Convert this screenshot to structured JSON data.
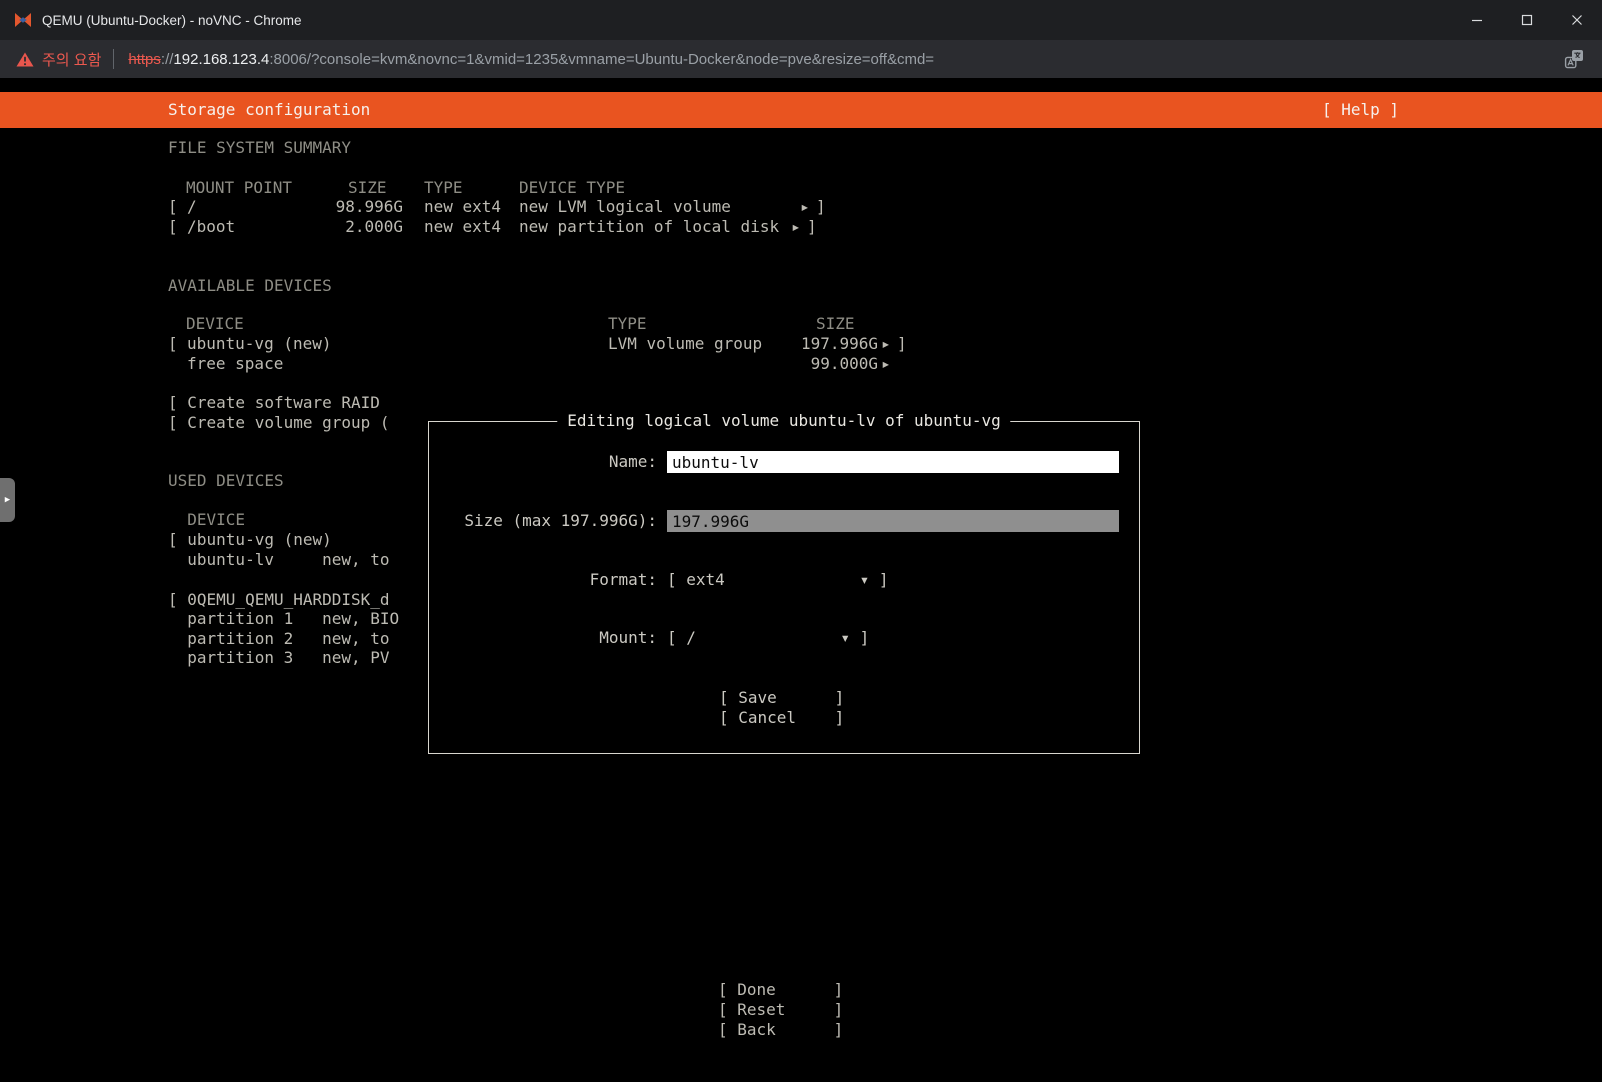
{
  "window": {
    "title": "QEMU (Ubuntu-Docker) - noVNC - Chrome"
  },
  "omnibox": {
    "warning": "주의 요함",
    "scheme": "https",
    "separator": "://",
    "host": "192.168.123.4",
    "path": ":8006/?console=kvm&novnc=1&vmid=1235&vmname=Ubuntu-Docker&node=pve&resize=off&cmd="
  },
  "header": {
    "title": "Storage configuration",
    "help": "[ Help ]"
  },
  "fs": {
    "heading": "FILE SYSTEM SUMMARY",
    "columns": {
      "mount": "MOUNT POINT",
      "size": "SIZE",
      "type": "TYPE",
      "device": "DEVICE TYPE"
    },
    "rows": [
      {
        "open": "[",
        "mount": "/",
        "size": "98.996G",
        "type": "new ext4",
        "device": "new LVM logical volume",
        "arrow": "▸",
        "close": "]"
      },
      {
        "open": "[",
        "mount": "/boot",
        "size": "2.000G",
        "type": "new ext4",
        "device": "new partition of local disk",
        "arrow": "▸",
        "close": "]"
      }
    ]
  },
  "available": {
    "heading": "AVAILABLE DEVICES",
    "columns": {
      "device": "DEVICE",
      "type": "TYPE",
      "size": "SIZE"
    },
    "vg_row": {
      "open": "[",
      "device": "ubuntu-vg (new)",
      "type": "LVM volume group",
      "size": "197.996G",
      "arrow": "▸",
      "close": "]"
    },
    "free_row": {
      "device": "free space",
      "size": "99.000G",
      "arrow": "▸"
    },
    "create_raid": "[ Create software RAID",
    "create_vg": "[ Create volume group ("
  },
  "used": {
    "heading": "USED DEVICES",
    "columns": "  DEVICE",
    "vg": "[ ubuntu-vg (new)",
    "lv": "  ubuntu-lv     new, to",
    "disk": "[ 0QEMU_QEMU_HARDDISK_d",
    "p1": "  partition 1   new, BIO",
    "p2": "  partition 2   new, to",
    "p3": "  partition 3   new, PV"
  },
  "dialog": {
    "title": "Editing logical volume ubuntu-lv of ubuntu-vg",
    "name_label": "Name:",
    "name_value": "ubuntu-lv",
    "size_label": "Size (max 197.996G):",
    "size_value": "197.996G",
    "format_label": "Format:",
    "format_value": "[ ext4              ▾ ]",
    "mount_label": "Mount:",
    "mount_value": "[ /               ▾ ]",
    "save": "[ Save      ]",
    "cancel": "[ Cancel    ]"
  },
  "footer": {
    "done": "[ Done      ]",
    "reset": "[ Reset     ]",
    "back": "[ Back      ]"
  },
  "novnc": {
    "handle_arrow": "▶"
  }
}
